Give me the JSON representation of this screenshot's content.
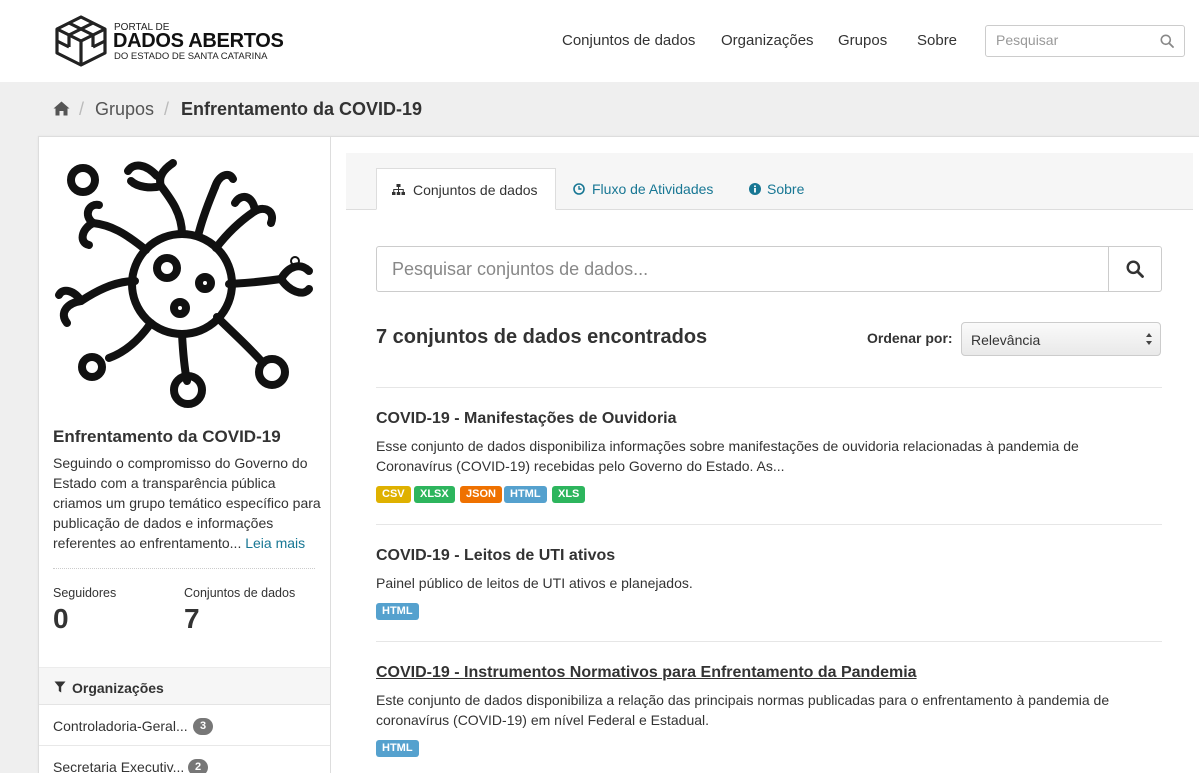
{
  "header": {
    "logo": {
      "line1": "PORTAL DE",
      "line2": "DADOS ABERTOS",
      "line3": "DO ESTADO DE SANTA CATARINA"
    },
    "nav": [
      "Conjuntos de dados",
      "Organizações",
      "Grupos",
      "Sobre"
    ],
    "search_placeholder": "Pesquisar"
  },
  "breadcrumb": {
    "home_icon": "home-icon",
    "items": [
      "Grupos",
      "Enfrentamento da COVID-19"
    ]
  },
  "sidebar": {
    "image_icon": "virus-icon",
    "title": "Enfrentamento da COVID-19",
    "description": "Seguindo o compromisso do Governo do Estado com a transparência pública criamos um grupo temático específico para publicação de dados e informações referentes ao enfrentamento...",
    "read_more": "Leia mais",
    "stats": [
      {
        "label": "Seguidores",
        "value": "0"
      },
      {
        "label": "Conjuntos de dados",
        "value": "7"
      }
    ],
    "facet": {
      "icon": "filter-icon",
      "title": "Organizações",
      "items": [
        {
          "name": "Controladoria-Geral...",
          "count": "3"
        },
        {
          "name": "Secretaria Executiv...",
          "count": "2"
        }
      ]
    }
  },
  "tabs": [
    {
      "label": "Conjuntos de dados",
      "icon": "sitemap-icon",
      "active": true
    },
    {
      "label": "Fluxo de Atividades",
      "icon": "clock-icon",
      "active": false
    },
    {
      "label": "Sobre",
      "icon": "info-icon",
      "active": false
    }
  ],
  "dataset_search": {
    "placeholder": "Pesquisar conjuntos de dados..."
  },
  "results": {
    "count_text": "7 conjuntos de dados encontrados",
    "sort_label": "Ordenar por:",
    "sort_value": "Relevância"
  },
  "colors": {
    "CSV": "#dfb100",
    "XLSX": "#2db55d",
    "JSON": "#ef7100",
    "HTML": "#55a1ce",
    "XLS": "#2db55d",
    "link": "#187794"
  },
  "datasets": [
    {
      "title": "COVID-19 - Manifestações de Ouvidoria",
      "notes": "Esse conjunto de dados disponibiliza informações sobre manifestações de ouvidoria relacionadas à pandemia de Coronavírus (COVID-19) recebidas pelo Governo do Estado. As...",
      "formats": [
        "CSV",
        "XLSX",
        "JSON",
        "HTML",
        "XLS"
      ]
    },
    {
      "title": "COVID-19 - Leitos de UTI ativos",
      "notes": "Painel público de leitos de UTI ativos e planejados.",
      "formats": [
        "HTML"
      ]
    },
    {
      "title": "COVID-19 - Instrumentos Normativos para Enfrentamento da Pandemia",
      "notes": "Este conjunto de dados disponibiliza a relação das principais normas publicadas para o enfrentamento à pandemia de coronavírus (COVID-19) em nível Federal e Estadual.",
      "formats": [
        "HTML"
      ]
    }
  ]
}
